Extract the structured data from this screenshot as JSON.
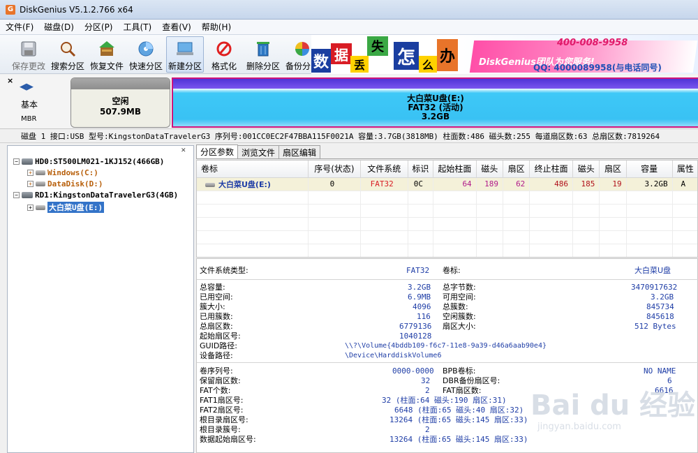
{
  "window": {
    "title": "DiskGenius V5.1.2.766 x64",
    "icon": "G"
  },
  "menu": [
    "文件(F)",
    "磁盘(D)",
    "分区(P)",
    "工具(T)",
    "查看(V)",
    "帮助(H)"
  ],
  "toolbar": [
    {
      "label": "保存更改",
      "icon": "save-icon"
    },
    {
      "label": "搜索分区",
      "icon": "magnifier-icon"
    },
    {
      "label": "恢复文件",
      "icon": "recover-icon"
    },
    {
      "label": "快速分区",
      "icon": "quick-partition-icon"
    },
    {
      "label": "新建分区",
      "icon": "new-partition-icon"
    },
    {
      "label": "格式化",
      "icon": "format-icon"
    },
    {
      "label": "删除分区",
      "icon": "trash-icon"
    },
    {
      "label": "备份分区",
      "icon": "backup-icon"
    }
  ],
  "banner": {
    "chars": [
      "数",
      "据",
      "丢",
      "失",
      "怎",
      "么",
      "办"
    ],
    "team": "DiskGenius团队为您服务!",
    "phone": "400-008-9958",
    "qq": "QQ: 4000089958(与电话同号)"
  },
  "diskmap": {
    "label1": "基本",
    "label2": "MBR",
    "free_name": "空闲",
    "free_size": "507.9MB",
    "part_name": "大白菜U盘(E:)",
    "part_fs": "FAT32 (活动)",
    "part_size": "3.2GB"
  },
  "diskinfo": "磁盘 1 接口:USB  型号:KingstonDataTravelerG3  序列号:001CC0EC2F47BBA115F0021A  容量:3.7GB(3818MB)  柱面数:486  磁头数:255  每道扇区数:63  总扇区数:7819264",
  "tree": {
    "nodes": [
      {
        "label": "HD0:ST500LM021-1KJ152(466GB)"
      },
      {
        "label": "Windows(C:)"
      },
      {
        "label": "DataDisk(D:)"
      },
      {
        "label": "RD1:KingstonDataTravelerG3(4GB)"
      },
      {
        "label": "大白菜U盘(E:)"
      }
    ]
  },
  "tabs": [
    "分区参数",
    "浏览文件",
    "扇区编辑"
  ],
  "grid": {
    "headers": [
      "卷标",
      "序号(状态)",
      "文件系统",
      "标识",
      "起始柱面",
      "磁头",
      "扇区",
      "终止柱面",
      "磁头",
      "扇区",
      "容量",
      "属性"
    ],
    "row": [
      "大白菜U盘(E:)",
      "0",
      "FAT32",
      "0C",
      "64",
      "189",
      "62",
      "486",
      "185",
      "19",
      "3.2GB",
      "A"
    ]
  },
  "info": {
    "fs_type_label": "文件系统类型:",
    "fs_type": "FAT32",
    "vol_label_label": "卷标:",
    "vol_label": "大白菜U盘",
    "left1": [
      [
        "总容量:",
        "3.2GB"
      ],
      [
        "已用空间:",
        "6.9MB"
      ],
      [
        "簇大小:",
        "4096"
      ],
      [
        "已用簇数:",
        "116"
      ],
      [
        "总扇区数:",
        "6779136"
      ],
      [
        "起始扇区号:",
        "1040128"
      ]
    ],
    "right1": [
      [
        "总字节数:",
        "3470917632"
      ],
      [
        "可用空间:",
        "3.2GB"
      ],
      [
        "总簇数:",
        "845734"
      ],
      [
        "空闲簇数:",
        "845618"
      ],
      [
        "扇区大小:",
        "512 Bytes"
      ]
    ],
    "guid_label": "GUID路径:",
    "guid": "\\\\?\\Volume{4bddb109-f6c7-11e8-9a39-d46a6aab90e4}",
    "dev_label": "设备路径:",
    "dev": "\\Device\\HarddiskVolume6",
    "left2": [
      [
        "卷序列号:",
        "0000-0000"
      ],
      [
        "保留扇区数:",
        "32"
      ],
      [
        "FAT个数:",
        "2"
      ],
      [
        "FAT1扇区号:",
        "32 (柱面:64 磁头:190 扇区:31)"
      ],
      [
        "FAT2扇区号:",
        "6648 (柱面:65 磁头:40 扇区:32)"
      ],
      [
        "根目录扇区号:",
        "13264 (柱面:65 磁头:145 扇区:33)"
      ],
      [
        "根目录簇号:",
        "2"
      ],
      [
        "数据起始扇区号:",
        "13264 (柱面:65 磁头:145 扇区:33)"
      ]
    ],
    "right2": [
      [
        "BPB卷标:",
        "NO NAME"
      ],
      [
        "DBR备份扇区号:",
        "6"
      ],
      [
        "FAT扇区数:",
        "6616"
      ]
    ]
  },
  "watermark": {
    "main": "Bai du 经验",
    "sub": "jingyan.baidu.com"
  }
}
